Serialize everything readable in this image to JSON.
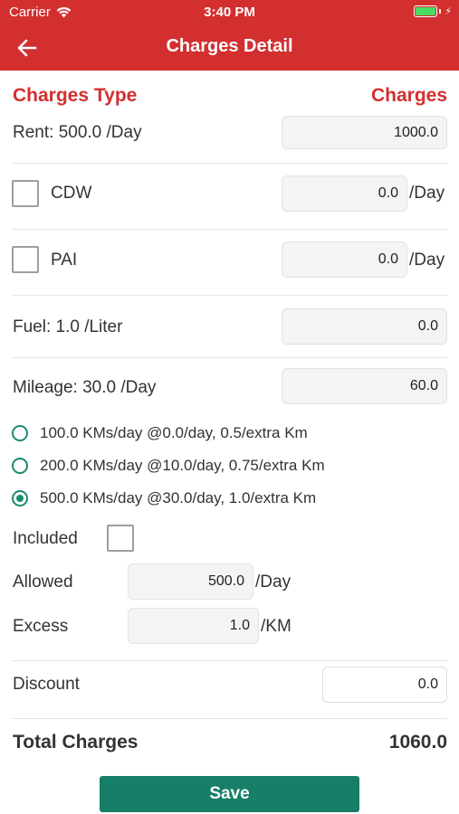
{
  "status_bar": {
    "carrier": "Carrier",
    "time": "3:40 PM"
  },
  "nav": {
    "title": "Charges Detail",
    "back_icon": "arrow-left-icon"
  },
  "header": {
    "charges_type": "Charges Type",
    "charges": "Charges"
  },
  "rent": {
    "label": "Rent: 500.0 /Day",
    "value": "1000.0"
  },
  "cdw": {
    "label": "CDW",
    "value": "0.0",
    "unit": "/Day",
    "checked": false
  },
  "pai": {
    "label": "PAI",
    "value": "0.0",
    "unit": "/Day",
    "checked": false
  },
  "fuel": {
    "label": "Fuel: 1.0 /Liter",
    "value": "0.0"
  },
  "mileage": {
    "label": "Mileage: 30.0 /Day",
    "value": "60.0",
    "options": [
      {
        "label": "100.0 KMs/day @0.0/day, 0.5/extra Km",
        "selected": false
      },
      {
        "label": "200.0 KMs/day @10.0/day, 0.75/extra Km",
        "selected": false
      },
      {
        "label": "500.0 KMs/day @30.0/day, 1.0/extra Km",
        "selected": true
      }
    ]
  },
  "included": {
    "label": "Included",
    "checked": false
  },
  "allowed": {
    "label": "Allowed",
    "value": "500.0",
    "unit": "/Day"
  },
  "excess": {
    "label": "Excess",
    "value": "1.0",
    "unit": "/KM"
  },
  "discount": {
    "label": "Discount",
    "value": "0.0"
  },
  "total": {
    "label": "Total Charges",
    "value": "1060.0"
  },
  "save": {
    "label": "Save"
  },
  "colors": {
    "primary_red": "#d32f2f",
    "accent_green": "#177e67",
    "radio_green": "#1a8a72"
  }
}
